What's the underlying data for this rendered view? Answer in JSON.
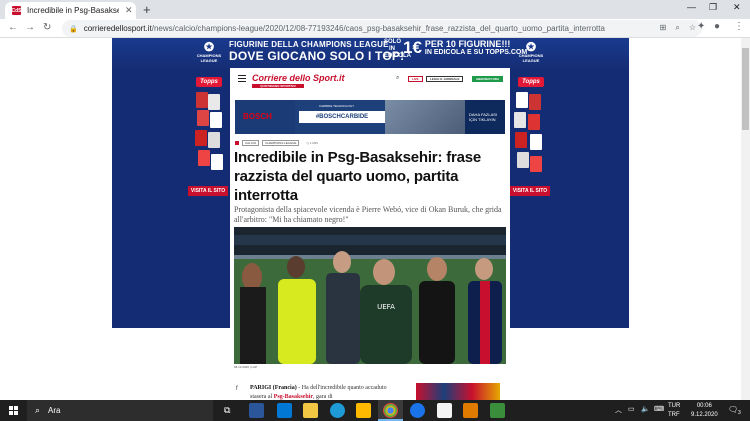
{
  "browser": {
    "tab_title": "Incredibile in Psg-Basaksehir: fras",
    "favicon_text": "CdS",
    "new_tab": "+",
    "url_domain": "corrieredellosport.it",
    "url_path": "/news/calcio/champions-league/2020/12/08-77193246/caos_psg-basaksehir_frase_razzista_del_quarto_uomo_partita_interrotta"
  },
  "skin_ad": {
    "line1": "FIGURINE DELLA CHAMPIONS LEAGUE",
    "line2": "DOVE GIOCANO SOLO I TOP!",
    "solo_label": "SOLO IN EDICOLA",
    "price": "1€",
    "promo_line1": "PER 10 FIGURINE!!!",
    "promo_line2": "IN EDICOLA E SU TOPPS.COM",
    "league_label": "CHAMPIONS LEAGUE",
    "brand": "Topps",
    "visit": "VISITA IL SITO"
  },
  "site": {
    "logo": "Corriere dello Sport.it",
    "logo_sub": "QUOTIDIANO SPORTIVO",
    "live": "LIVE",
    "read_paper": "LEGGI IL GIORNALE",
    "subscribe": "ABBONATI ORA"
  },
  "bosch_ad": {
    "brand": "BOSCH",
    "top_text": "CARBIDE TECHNOLOGY",
    "hashtag": "#BOSCHCARBIDE",
    "cta": "DAHA FAZLASI İÇİN TIKLAYIN"
  },
  "article": {
    "tags": [
      "CALCIO",
      "CHAMPIONS LEAGUE"
    ],
    "read_time": "1 MIN",
    "headline": "Incredibile in Psg-Basaksehir: frase razzista del quarto uomo, partita interrotta",
    "subtitle": "Protagonista della spiacevole vicenda è Pierre Webó, vice di Okan Buruk, che grida all'arbitro: \"Mi ha chiamato negro!\"",
    "photo_credit": "08.12.2020 | LAP",
    "body_city": "PARIGI (Francia)",
    "body_text": " - Ha dell'incredibile quanto accaduto stasera al ",
    "body_link": "Psg-Basaksehir",
    "body_end": ", gara di"
  },
  "taskbar": {
    "search_placeholder": "Ara",
    "lang_line1": "TUR",
    "lang_line2": "TRF",
    "time": "00:06",
    "date": "9.12.2020",
    "notifications": "3"
  }
}
